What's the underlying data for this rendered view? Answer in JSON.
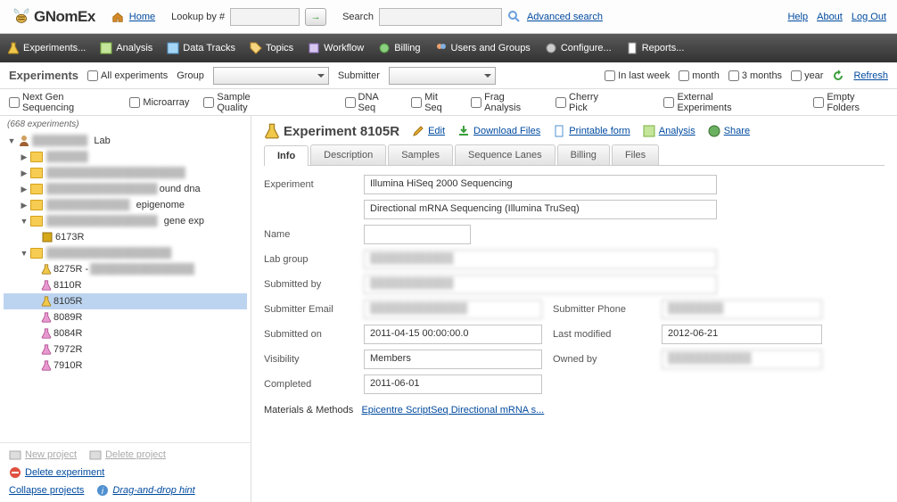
{
  "header": {
    "brand": "GNomEx",
    "home": "Home",
    "lookup": "Lookup by #",
    "search": "Search",
    "advanced": "Advanced search",
    "help": "Help",
    "about": "About",
    "logout": "Log Out"
  },
  "menu": [
    "Experiments...",
    "Analysis",
    "Data Tracks",
    "Topics",
    "Workflow",
    "Billing",
    "Users and Groups",
    "Configure...",
    "Reports..."
  ],
  "fb": {
    "title": "Experiments",
    "allexp": "All experiments",
    "group": "Group",
    "group_val": "",
    "submitter": "Submitter",
    "lastweek": "In last week",
    "month": "month",
    "three": "3 months",
    "year": "year",
    "refresh": "Refresh"
  },
  "fb2": {
    "ngs": "Next Gen Sequencing",
    "micro": "Microarray",
    "sq": "Sample Quality",
    "dna": "DNA Seq",
    "mit": "Mit Seq",
    "frag": "Frag Analysis",
    "cherry": "Cherry Pick",
    "ext": "External Experiments",
    "empty": "Empty Folders"
  },
  "tree": {
    "count": "(668 experiments)",
    "lab": "Lab",
    "ep": "epigenome",
    "ge": "gene exp",
    "bound": "ound dna",
    "i6173": "6173R",
    "i8275": "8275R - ",
    "i8110": "8110R",
    "i8105": "8105R",
    "i8089": "8089R",
    "i8084": "8084R",
    "i7972": "7972R",
    "i7910": "7910R"
  },
  "sf": {
    "newp": "New project",
    "delp": "Delete project",
    "dele": "Delete experiment",
    "coll": "Collapse projects",
    "hint": "Drag-and-drop hint"
  },
  "det": {
    "title": "Experiment 8105R",
    "edit": "Edit",
    "dl": "Download Files",
    "print": "Printable form",
    "ana": "Analysis",
    "share": "Share"
  },
  "tabs": [
    "Info",
    "Description",
    "Samples",
    "Sequence Lanes",
    "Billing",
    "Files"
  ],
  "info": {
    "experiment": "Experiment",
    "exp_val": "Illumina HiSeq 2000 Sequencing",
    "exp_val2": "Directional mRNA Sequencing (Illumina TruSeq)",
    "name": "Name",
    "name_val": "",
    "lab": "Lab group",
    "lab_val": "",
    "sub": "Submitted by",
    "sub_val": "",
    "email": "Submitter Email",
    "email_val": "",
    "phone": "Submitter Phone",
    "phone_val": "",
    "subon": "Submitted on",
    "subon_val": "2011-04-15 00:00:00.0",
    "mod": "Last modified",
    "mod_val": "2012-06-21",
    "vis": "Visibility",
    "vis_val": "Members",
    "owned": "Owned by",
    "owned_val": "",
    "comp": "Completed",
    "comp_val": "2011-06-01",
    "mats": "Materials & Methods",
    "mats_link": "Epicentre ScriptSeq Directional mRNA s..."
  }
}
